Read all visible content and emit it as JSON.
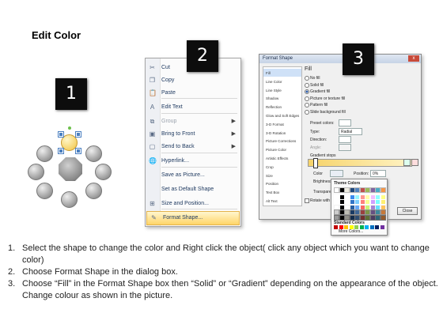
{
  "title": "Edit Color",
  "badges": [
    "1",
    "2",
    "3"
  ],
  "context_menu": {
    "items": [
      {
        "label": "Cut",
        "icon": "scissors-icon",
        "glyph": "✂",
        "disabled": false,
        "submenu": false
      },
      {
        "label": "Copy",
        "icon": "copy-icon",
        "glyph": "❐",
        "disabled": false,
        "submenu": false
      },
      {
        "label": "Paste",
        "icon": "paste-icon",
        "glyph": "📋",
        "disabled": false,
        "submenu": false
      },
      {
        "label": "Edit Text",
        "icon": "edit-text-icon",
        "glyph": "A",
        "disabled": false,
        "submenu": false
      },
      {
        "label": "Group",
        "icon": "group-icon",
        "glyph": "⧉",
        "disabled": true,
        "submenu": true
      },
      {
        "label": "Bring to Front",
        "icon": "bring-front-icon",
        "glyph": "▣",
        "disabled": false,
        "submenu": true
      },
      {
        "label": "Send to Back",
        "icon": "send-back-icon",
        "glyph": "▢",
        "disabled": false,
        "submenu": true
      },
      {
        "label": "Hyperlink...",
        "icon": "hyperlink-icon",
        "glyph": "🌐",
        "disabled": false,
        "submenu": false
      },
      {
        "label": "Save as Picture...",
        "icon": "",
        "glyph": "",
        "disabled": false,
        "submenu": false
      },
      {
        "label": "Set as Default Shape",
        "icon": "",
        "glyph": "",
        "disabled": false,
        "submenu": false
      },
      {
        "label": "Size and Position...",
        "icon": "size-position-icon",
        "glyph": "⊞",
        "disabled": false,
        "submenu": false
      },
      {
        "label": "Format Shape...",
        "icon": "format-shape-icon",
        "glyph": "✎",
        "disabled": false,
        "submenu": false,
        "highlighted": true
      }
    ]
  },
  "format_dialog": {
    "title": "Format Shape",
    "close": "x",
    "nav": [
      "Fill",
      "Line Color",
      "Line Style",
      "Shadow",
      "Reflection",
      "Glow and Soft Edges",
      "3-D Format",
      "3-D Rotation",
      "Picture Corrections",
      "Picture Color",
      "Artistic Effects",
      "Crop",
      "Size",
      "Position",
      "Text Box",
      "Alt Text"
    ],
    "section": "Fill",
    "fill_options": [
      "No fill",
      "Solid fill",
      "Gradient fill",
      "Picture or texture fill",
      "Pattern fill",
      "Slide background fill"
    ],
    "labels": {
      "preset": "Preset colors:",
      "type": "Type:",
      "type_value": "Radial",
      "direction": "Direction:",
      "angle": "Angle:",
      "stops": "Gradient stops",
      "color": "Color",
      "position": "Position:",
      "position_value": "0%",
      "brightness": "Brightness:",
      "transparency": "Transparency:",
      "rotate": "Rotate with shape",
      "theme_colors": "Theme Colors",
      "standard_colors": "Standard Colors",
      "more_colors": "More Colors...",
      "close_button": "Close"
    }
  },
  "instructions": [
    {
      "n": "1.",
      "text": "Select the shape to change the color and Right click the object( click any object which you want to change color)"
    },
    {
      "n": "2.",
      "text": "Choose Format Shape in the dialog box."
    },
    {
      "n": "3.",
      "text": "Choose “Fill” in the Format Shape box then “Solid” or “Gradient” depending on the appearance of the object. Change colour as shown in the picture."
    }
  ],
  "colors": {
    "selected_shape": "#f6d36a",
    "menu_highlight": "#ffd567",
    "badge_bg": "#0d0d0d"
  }
}
